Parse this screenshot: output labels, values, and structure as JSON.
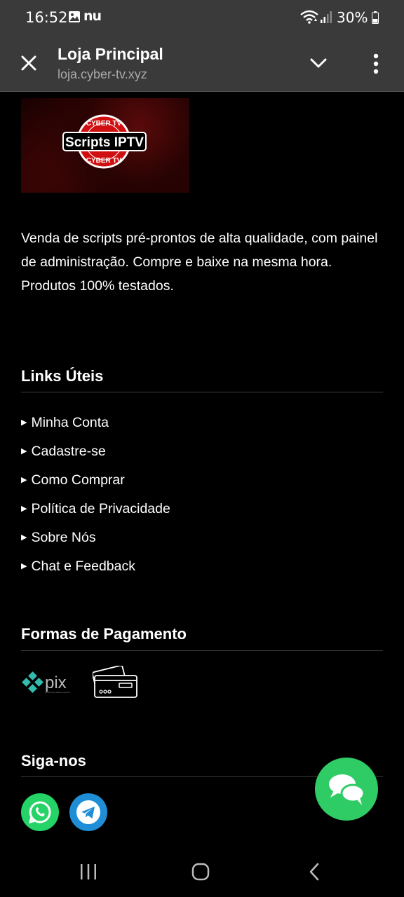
{
  "status_bar": {
    "time": "16:52",
    "notification_icons": [
      "gallery-icon"
    ],
    "carrier_badge": "nu",
    "battery": "30%"
  },
  "app_bar": {
    "title": "Loja Principal",
    "url": "loja.cyber-tv.xyz"
  },
  "logo": {
    "top_text": "CYBER TV",
    "main_text": "Scripts IPTV",
    "bottom_text": "CYBER TV"
  },
  "description": "Venda de scripts pré-prontos de alta qualidade, com painel de administração. Compre e baixe na mesma hora. Produtos 100% testados.",
  "useful_links": {
    "title": "Links Úteis",
    "items": [
      {
        "label": "Minha Conta"
      },
      {
        "label": "Cadastre-se"
      },
      {
        "label": "Como Comprar"
      },
      {
        "label": "Política de Privacidade"
      },
      {
        "label": "Sobre Nós"
      },
      {
        "label": "Chat e Feedback"
      }
    ]
  },
  "payment": {
    "title": "Formas de Pagamento",
    "pix_label": "pix",
    "pix_sublabel": "powered by Banco Central",
    "methods": [
      "pix-icon",
      "credit-card-icon"
    ]
  },
  "social": {
    "title": "Siga-nos",
    "networks": [
      "whatsapp-icon",
      "telegram-icon"
    ]
  },
  "colors": {
    "bars": "#3a3a3a",
    "whatsapp": "#25d366",
    "telegram": "#1f8ed6",
    "chat_fab": "#2fcc66",
    "pix": "#32bcad",
    "logo_red": "#d01010"
  }
}
